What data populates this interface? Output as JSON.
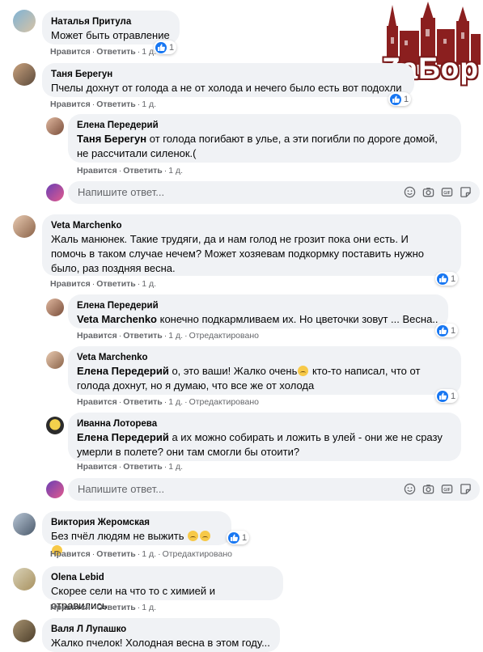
{
  "logo": {
    "text": "ZaБор"
  },
  "actions": {
    "like": "Нравится",
    "reply": "Ответить",
    "edited": "Отредактировано"
  },
  "placeholder": "Напишите ответ...",
  "comments": [
    {
      "author": "Наталья Притула",
      "text": "Может быть отравление",
      "time": "1 д.",
      "reactions": "1"
    },
    {
      "author": "Таня Берегун",
      "text": "Пчелы дохнут от голода а не от холода и нечего было есть вот подохли",
      "time": "1 д.",
      "reactions": "1"
    },
    {
      "author": "Елена Передерий",
      "mention": "Таня Берегун",
      "text": " от голода погибают в улье, а эти погибли по дороге домой,\nне рассчитали силенок.(",
      "time": "1 д."
    },
    {
      "author": "Veta Marchenko",
      "text": "Жаль манюнек. Такие трудяги, да и нам голод не грозит пока они есть. И\nпомочь в таком случае нечем? Может хозяевам подкормку поставить нужно\nбыло, раз поздняя весна.",
      "time": "1 д.",
      "reactions": "1"
    },
    {
      "author": "Елена Передерий",
      "mention": "Veta Marchenko",
      "text": " конечно подкармливаем их. Но цветочки зовут ... Весна..",
      "time": "1 д.",
      "reactions": "1"
    },
    {
      "author": "Veta Marchenko",
      "mention": "Елена Передерий",
      "text_a": " о, это ваши! Жалко очень",
      "text_b": " кто-то написал, что от\nголода дохнут, но я думаю, что все же от холода",
      "time": "1 д.",
      "reactions": "1"
    },
    {
      "author": "Иванна Лоторева",
      "mention": "Елена Передерий",
      "text": " а их можно собирать и ложить в улей - они же не сразу\nумерли в полете? они там смогли бы отоити?",
      "time": "1 д."
    },
    {
      "author": "Виктория Жеромская",
      "text": "Без пчёл людям не выжить",
      "time": "1 д.",
      "reactions": "1"
    },
    {
      "author": "Olena Lebid",
      "text": "Скорее сели на что то с химией и отравились",
      "time": "1 д."
    },
    {
      "author": "Валя Л Лупашко",
      "text": "Жалко пчелок! Холодная весна в этом году..."
    }
  ]
}
